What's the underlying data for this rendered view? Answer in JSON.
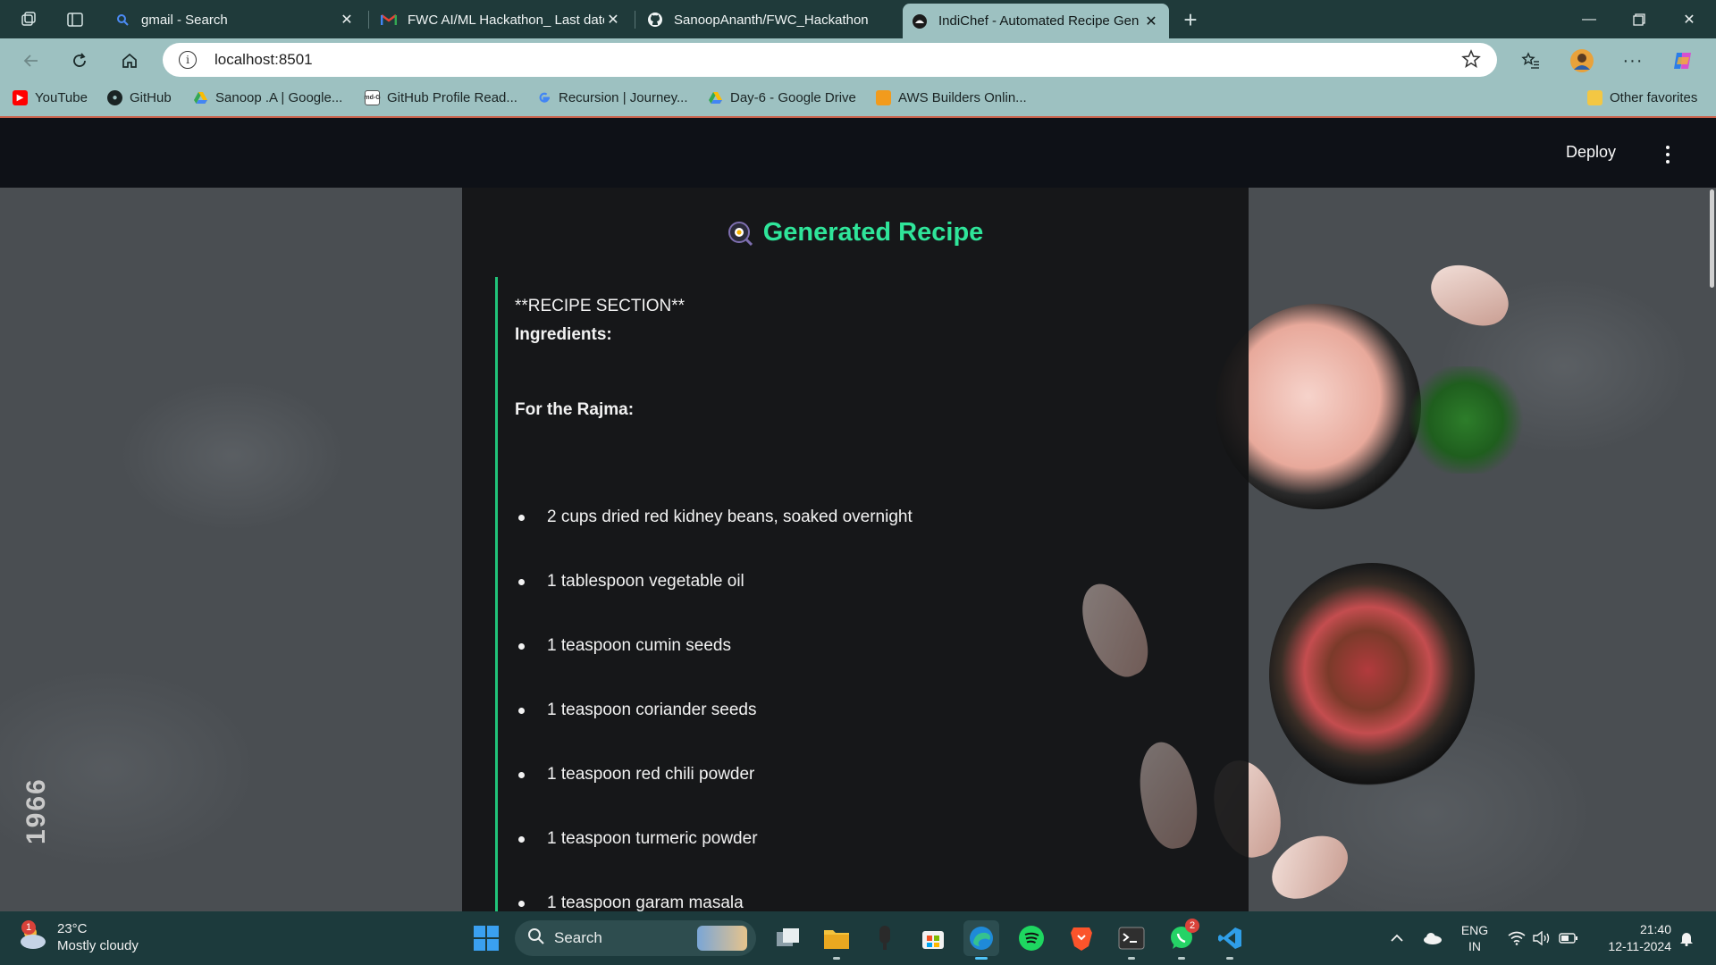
{
  "browser": {
    "tabs": [
      {
        "title": "gmail - Search",
        "favicon": "search-icon"
      },
      {
        "title": "FWC AI/ML Hackathon_ Last date",
        "favicon": "gmail-icon"
      },
      {
        "title": "SanoopAnanth/FWC_Hackathon",
        "favicon": "github-icon"
      },
      {
        "title": "IndiChef - Automated Recipe Gen",
        "favicon": "streamlit-icon",
        "active": true
      }
    ],
    "url": "localhost:8501",
    "bookmarks": [
      {
        "label": "YouTube",
        "icon": "youtube-icon"
      },
      {
        "label": "GitHub",
        "icon": "github-icon"
      },
      {
        "label": "Sanoop .A | Google...",
        "icon": "google-drive-icon"
      },
      {
        "label": "GitHub Profile Read...",
        "icon": "md-icon",
        "icon_text": "md-G"
      },
      {
        "label": "Recursion | Journey...",
        "icon": "google-icon"
      },
      {
        "label": "Day-6 - Google Drive",
        "icon": "google-drive-icon"
      },
      {
        "label": "AWS Builders Onlin...",
        "icon": "aws-icon"
      }
    ],
    "other_favorites": "Other favorites"
  },
  "app": {
    "deploy_label": "Deploy",
    "heading": "Generated Recipe",
    "recipe": {
      "section_line": "**RECIPE SECTION**",
      "ingredients_label": "Ingredients:",
      "subheading": "For the Rajma:",
      "ingredients": [
        "2 cups dried red kidney beans, soaked overnight",
        "1 tablespoon vegetable oil",
        "1 teaspoon cumin seeds",
        "1 teaspoon coriander seeds",
        "1 teaspoon red chili powder",
        "1 teaspoon turmeric powder",
        "1 teaspoon garam masala"
      ]
    },
    "side_text": "1966"
  },
  "taskbar": {
    "weather": {
      "temp": "23°C",
      "condition": "Mostly cloudy",
      "badge": "1"
    },
    "search_label": "Search",
    "whatsapp_badge": "2",
    "language": {
      "line1": "ENG",
      "line2": "IN"
    },
    "clock": {
      "time": "21:40",
      "date": "12-11-2024"
    }
  },
  "colors": {
    "accent_green": "#2fe59a",
    "border_green": "#21c47a",
    "tab_bar": "#1f3a3a",
    "chrome": "#9dc1c1",
    "taskbar": "#1c3a3c"
  }
}
